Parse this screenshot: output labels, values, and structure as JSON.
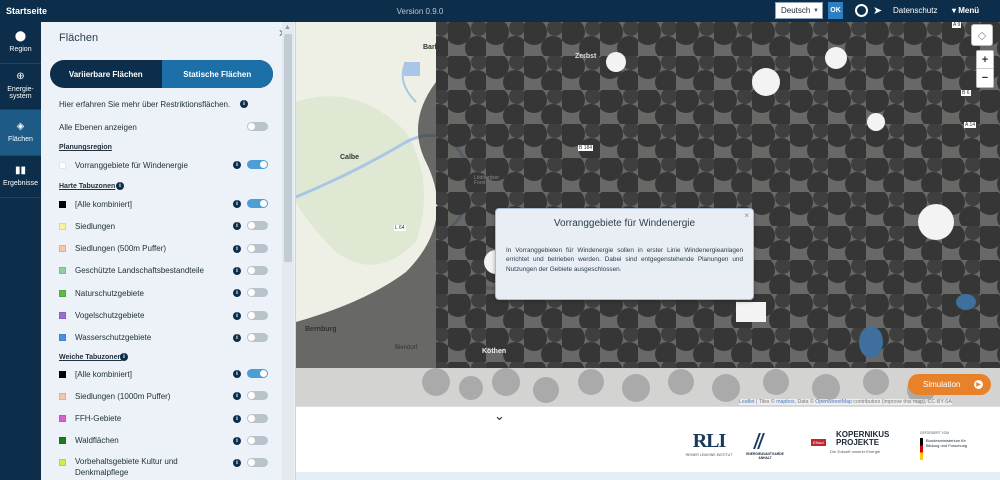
{
  "topbar": {
    "home_label": "Startseite",
    "version": "Version 0.9.0",
    "language": "Deutsch",
    "ok_label": "OK",
    "privacy_label": "Datenschutz",
    "menu_label": "Menü"
  },
  "nav": {
    "items": [
      {
        "label": "Region",
        "icon": "map-marker-icon"
      },
      {
        "label": "Energie-system",
        "icon": "energy-icon"
      },
      {
        "label": "Flächen",
        "icon": "layers-icon"
      },
      {
        "label": "Ergebnisse",
        "icon": "bar-chart-icon"
      }
    ]
  },
  "panel": {
    "title": "Flächen",
    "tab_variable": "Variierbare Flächen",
    "tab_static": "Statische Flächen",
    "info_text": "Hier erfahren Sie mehr über Restriktionsflächen.",
    "show_all_label": "Alle Ebenen anzeigen",
    "sections": {
      "planning": "Planungsregion",
      "hard": "Harte Tabuzonen",
      "soft": "Weiche Tabuzonen"
    },
    "planning_items": [
      {
        "label": "Vorranggebiete für Windenergie",
        "color": "#ffffff",
        "on": true
      }
    ],
    "hard_items": [
      {
        "label": "[Alle kombiniert]",
        "color": "#000000",
        "on": true
      },
      {
        "label": "Siedlungen",
        "color": "#f6f39a",
        "on": false
      },
      {
        "label": "Siedlungen (500m Puffer)",
        "color": "#f7c6a3",
        "on": false
      },
      {
        "label": "Geschützte Landschaftsbestandteile",
        "color": "#8fd0a0",
        "on": false
      },
      {
        "label": "Naturschutzgebiete",
        "color": "#5fb84a",
        "on": false
      },
      {
        "label": "Vogelschutzgebiete",
        "color": "#9b6fd0",
        "on": false
      },
      {
        "label": "Wasserschutzgebiete",
        "color": "#4a8fe0",
        "on": false
      }
    ],
    "soft_items": [
      {
        "label": "[Alle kombiniert]",
        "color": "#000000",
        "on": true
      },
      {
        "label": "Siedlungen (1000m Puffer)",
        "color": "#f7c6a3",
        "on": false
      },
      {
        "label": "FFH-Gebiete",
        "color": "#d85fd0",
        "on": false
      },
      {
        "label": "Waldflächen",
        "color": "#1f7a1f",
        "on": false
      },
      {
        "label": "Vorbehaltsgebiete Kultur und Denkmalpflege",
        "color": "#d6e84a",
        "on": false
      }
    ]
  },
  "map": {
    "places": [
      "Barby",
      "Zerbst",
      "Calbe",
      "Bernburg",
      "Biendorf",
      "Köthen",
      "Lödderitzer Forst"
    ],
    "roads": [
      "B 184",
      "L 64",
      "B 185",
      "A 9",
      "B 6",
      "B 185",
      "A 14"
    ],
    "popup": {
      "title": "Vorranggebiete für Windenergie",
      "text": "In Vorranggebieten für Windenergie sollen in erster Linie Windenergieanlagen errichtet und betrieben werden. Dabei sind entgegenstehende Planungen und Nutzungen der Gebiete ausgeschlossen."
    },
    "simulation_label": "Simulation",
    "attribution": {
      "leaflet": "Leaflet",
      "tiles": " | Tiles © ",
      "mapbox": "mapbox",
      "data": ", Data © ",
      "osm": "OpenStreetMap",
      "rest": " contributors (improve this map), CC-BY-SA"
    }
  },
  "footer": {
    "logos": [
      {
        "main": "RLI",
        "sub": "REINER LEMOINE INSTITUT"
      },
      {
        "main": "ENERGIEAVANTGARDE ANHALT",
        "sub": ""
      },
      {
        "main": "KOPERNIKUS PROJEKTE",
        "sub": "Die Zukunft unserer Energie",
        "badge": "ENavi"
      },
      {
        "main": "Bundesministerium für Bildung und Forschung",
        "sub": "GEFÖRDERT VOM"
      }
    ]
  }
}
